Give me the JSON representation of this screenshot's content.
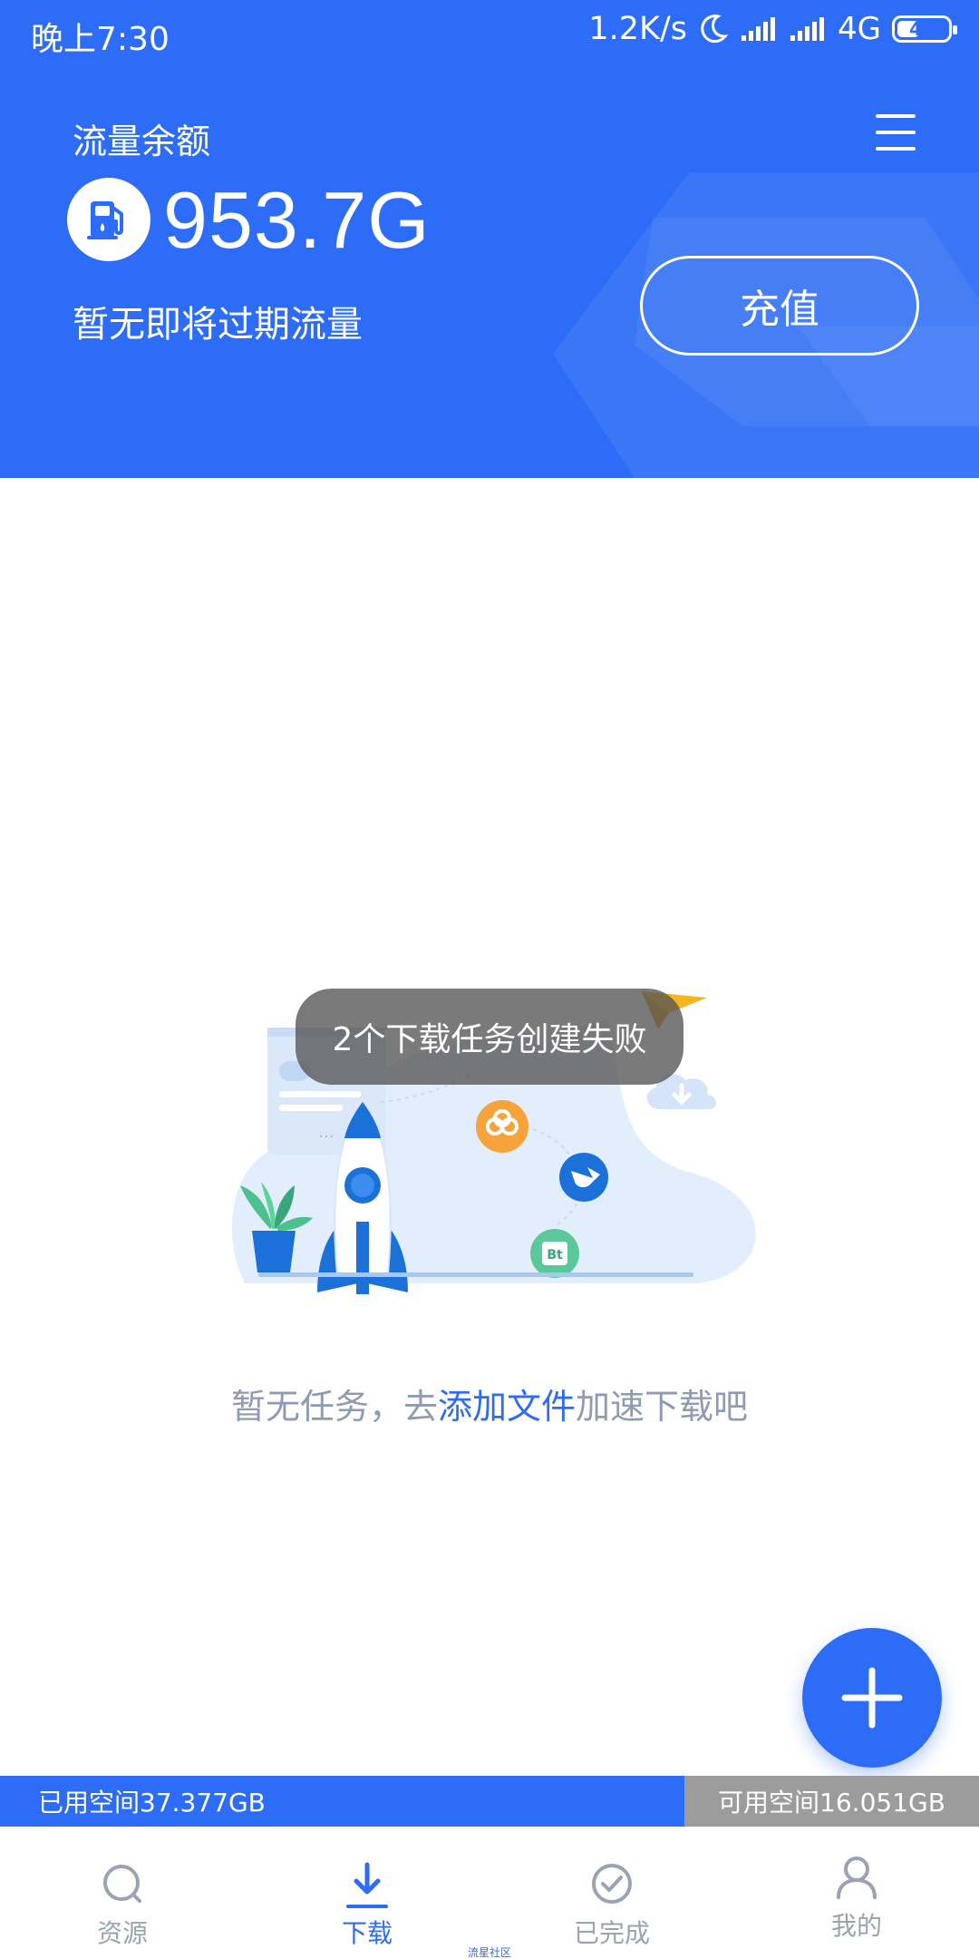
{
  "status_bar": {
    "time": "晚上7:30",
    "speed": "1.2K/s",
    "network": "4G",
    "battery": "40"
  },
  "header": {
    "balance_label": "流量余额",
    "balance_value": "953.7G",
    "expire_text": "暂无即将过期流量",
    "recharge_label": "充值",
    "icons": [
      "menu-icon",
      "fuel-pump-icon"
    ]
  },
  "toast": {
    "message": "2个下载任务创建失败"
  },
  "empty_state": {
    "text_before": "暂无任务，去",
    "link_text": "添加文件",
    "text_after": "加速下载吧",
    "badge_bt": "Bt",
    "illustration_icons": [
      "rocket-icon",
      "plant-icon",
      "cloud-download-icon",
      "baidu-cloud-icon",
      "xunlei-bird-icon",
      "bt-icon",
      "paper-plane-icon"
    ]
  },
  "storage": {
    "used": "已用空间37.377GB",
    "free": "可用空间16.051GB"
  },
  "tabs": [
    {
      "label": "资源",
      "icon": "search-icon",
      "active": false
    },
    {
      "label": "下载",
      "icon": "download-icon",
      "active": true
    },
    {
      "label": "已完成",
      "icon": "check-circle-icon",
      "active": false
    },
    {
      "label": "我的",
      "icon": "user-icon",
      "active": false
    }
  ],
  "watermark": "流星社区",
  "colors": {
    "primary": "#2d6cf6",
    "storage_free": "#9c9c9c",
    "muted_text": "#8e9bb0"
  }
}
